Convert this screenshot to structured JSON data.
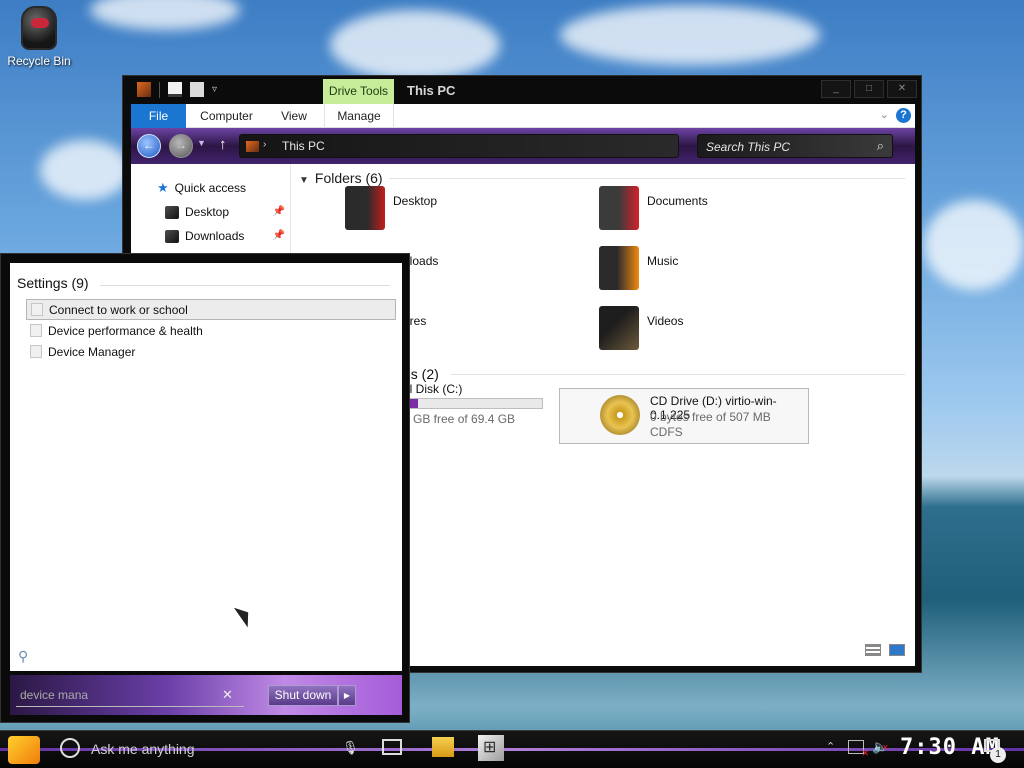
{
  "desktop": {
    "recycle_bin_label": "Recycle Bin"
  },
  "explorer": {
    "title": "This PC",
    "contextual_tab": "Drive Tools",
    "ribbon_tabs": {
      "file": "File",
      "computer": "Computer",
      "view": "View",
      "manage": "Manage"
    },
    "address_path": "This PC",
    "search_placeholder": "Search This PC",
    "nav": {
      "quick_access": "Quick access",
      "desktop": "Desktop",
      "downloads": "Downloads"
    },
    "folders_header": "Folders (6)",
    "folders": {
      "desktop": "Desktop",
      "documents": "Documents",
      "downloads_partial": "nloads",
      "music": "Music",
      "pictures_partial": "ures",
      "videos": "Videos"
    },
    "devices_header_partial": "es (2)",
    "local_disk": {
      "name_partial": "al Disk (C:)",
      "free_partial": "3 GB free of 69.4 GB",
      "used_fraction": 0.1
    },
    "cd_drive": {
      "name": "CD Drive (D:) virtio-win-0.1.225",
      "free": "0 bytes free of 507 MB",
      "fs": "CDFS"
    },
    "colors": {
      "accent": "#1b76d2",
      "drive_tools": "#c7ec9a",
      "purple": "#6d43a5"
    }
  },
  "start_panel": {
    "results_title": "Settings (9)",
    "results": [
      "Connect to work or school",
      "Device performance & health",
      "Device Manager"
    ],
    "search_value": "device mana",
    "shutdown_label": "Shut down"
  },
  "taskbar": {
    "search_placeholder": "Ask me anything",
    "clock": "7:30 AM",
    "notification_count": "1"
  }
}
